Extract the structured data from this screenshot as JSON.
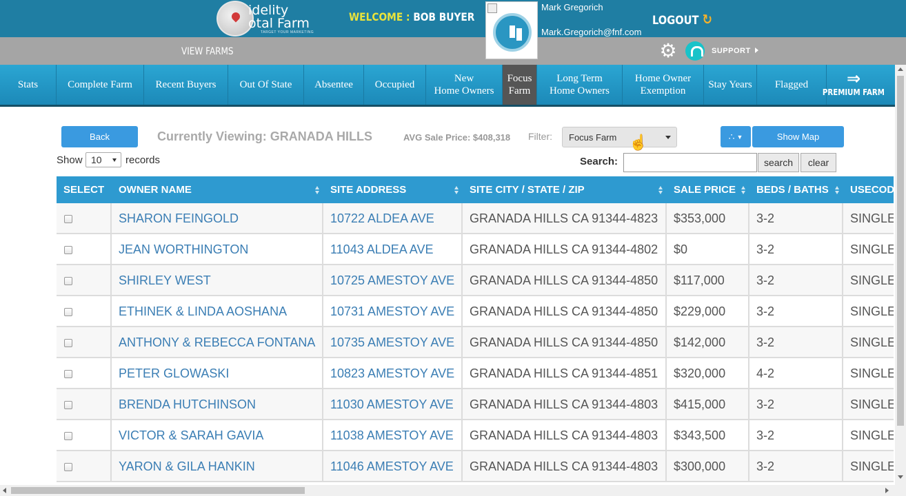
{
  "header": {
    "logo_text_line1": "idelity",
    "logo_text_line2": "otal Farm",
    "logo_tagline": "TARGET YOUR MARKETING",
    "welcome_label": "WELCOME :",
    "welcome_user": "BOB BUYER",
    "agent_name": "Mark Gregorich",
    "agent_email": "Mark.Gregorich@fnf.com",
    "logout_label": "LOGOUT"
  },
  "subbar": {
    "view_farms": "VIEW FARMS",
    "support_label": "SUPPORT"
  },
  "nav": {
    "tabs": [
      {
        "label": "Stats"
      },
      {
        "label": "Complete Farm"
      },
      {
        "label": "Recent Buyers"
      },
      {
        "label": "Out Of State"
      },
      {
        "label": "Absentee"
      },
      {
        "label": "Occupied"
      },
      {
        "label": "New\nHome Owners"
      },
      {
        "label": "Focus\nFarm"
      },
      {
        "label": "Long Term\nHome Owners"
      },
      {
        "label": "Home Owner\nExemption"
      },
      {
        "label": "Stay Years"
      },
      {
        "label": "Flagged"
      }
    ],
    "active_tab": "Focus Farm",
    "premium_label": "PREMIUM FARM"
  },
  "controls": {
    "back_label": "Back",
    "currently_viewing": "Currently Viewing: GRANADA HILLS",
    "avg_sale_price": "AVG Sale Price: $408,318",
    "filter_label": "Filter:",
    "filter_value": "Focus Farm",
    "show_map_label": "Show Map",
    "show_label": "Show",
    "records_per_page": "10",
    "records_label": "records",
    "search_label": "Search:",
    "search_value": "",
    "search_button": "search",
    "clear_button": "clear"
  },
  "table": {
    "columns": [
      "SELECT",
      "OWNER NAME",
      "SITE ADDRESS",
      "SITE CITY / STATE / ZIP",
      "SALE PRICE",
      "BEDS / BATHS",
      "USECODE"
    ],
    "rows": [
      {
        "owner": "SHARON FEINGOLD",
        "address": "10722 ALDEA AVE",
        "city": "GRANADA HILLS CA 91344-4823",
        "price": "$353,000",
        "beds": "3-2",
        "usecode": "SINGLE"
      },
      {
        "owner": "JEAN WORTHINGTON",
        "address": "11043 ALDEA AVE",
        "city": "GRANADA HILLS CA 91344-4802",
        "price": "$0",
        "beds": "3-2",
        "usecode": "SINGLE"
      },
      {
        "owner": "SHIRLEY WEST",
        "address": "10725 AMESTOY AVE",
        "city": "GRANADA HILLS CA 91344-4850",
        "price": "$117,000",
        "beds": "3-2",
        "usecode": "SINGLE"
      },
      {
        "owner": "ETHINEK & LINDA AOSHANA",
        "address": "10731 AMESTOY AVE",
        "city": "GRANADA HILLS CA 91344-4850",
        "price": "$229,000",
        "beds": "3-2",
        "usecode": "SINGLE"
      },
      {
        "owner": "ANTHONY & REBECCA FONTANA",
        "address": "10735 AMESTOY AVE",
        "city": "GRANADA HILLS CA 91344-4850",
        "price": "$142,000",
        "beds": "3-2",
        "usecode": "SINGLE"
      },
      {
        "owner": "PETER GLOWASKI",
        "address": "10823 AMESTOY AVE",
        "city": "GRANADA HILLS CA 91344-4851",
        "price": "$320,000",
        "beds": "4-2",
        "usecode": "SINGLE"
      },
      {
        "owner": "BRENDA HUTCHINSON",
        "address": "11030 AMESTOY AVE",
        "city": "GRANADA HILLS CA 91344-4803",
        "price": "$415,000",
        "beds": "3-2",
        "usecode": "SINGLE"
      },
      {
        "owner": "VICTOR & SARAH GAVIA",
        "address": "11038 AMESTOY AVE",
        "city": "GRANADA HILLS CA 91344-4803",
        "price": "$343,500",
        "beds": "3-2",
        "usecode": "SINGLE"
      },
      {
        "owner": "YARON & GILA HANKIN",
        "address": "11046 AMESTOY AVE",
        "city": "GRANADA HILLS CA 91344-4803",
        "price": "$300,000",
        "beds": "3-2",
        "usecode": "SINGLE"
      }
    ]
  },
  "colors": {
    "header_blue": "#1f7ea3",
    "nav_blue": "#2ba6d3",
    "table_header_blue": "#2e9ad0",
    "button_blue": "#3a9ae0",
    "link_blue": "#3b7eb4",
    "welcome_yellow": "#e9e33c",
    "active_tab_grey": "#555555"
  },
  "icons": [
    "map-pin-icon",
    "logout-icon",
    "gear-icon",
    "headset-icon",
    "chevron-right-icon",
    "double-arrow-icon",
    "share-icon",
    "dropdown-caret-icon",
    "sort-icon",
    "checkbox-icon"
  ]
}
